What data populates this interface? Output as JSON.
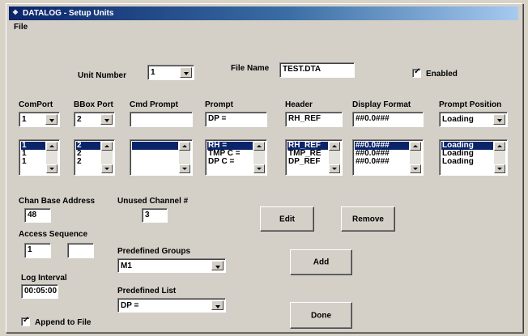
{
  "window": {
    "title": "DATALOG - Setup Units"
  },
  "menu": {
    "items": [
      "File"
    ]
  },
  "unit": {
    "number_label": "Unit Number",
    "number_value": "1",
    "filename_label": "File Name",
    "filename_value": "TEST.DTA",
    "enabled_label": "Enabled",
    "enabled": true
  },
  "columns": {
    "comport": "ComPort",
    "bbox_port": "BBox Port",
    "cmd_prompt": "Cmd Prompt",
    "prompt": "Prompt",
    "header": "Header",
    "display_format": "Display Format",
    "prompt_position": "Prompt  Position"
  },
  "edit_row": {
    "comport": "1",
    "bbox_port": "2",
    "cmd_prompt": "",
    "prompt": "DP  =",
    "header": "RH_REF",
    "display_format": "##0.0###",
    "prompt_position": "Loading"
  },
  "lists": {
    "comport": [
      "1",
      "1",
      "1"
    ],
    "bbox_port": [
      "2",
      "2",
      "2"
    ],
    "cmd_prompt": [
      "",
      "",
      ""
    ],
    "prompt": [
      "RH  =",
      "TMP C  =",
      "DP C  ="
    ],
    "header": [
      "RH_REF",
      "TMP_RE",
      "DP_REF"
    ],
    "display_format": [
      "##0.0###",
      "##0.0###",
      "##0.0###"
    ],
    "prompt_position": [
      "Loading",
      "Loading",
      "Loading"
    ]
  },
  "chan": {
    "base_label": "Chan Base Address",
    "base_value": "48",
    "unused_label": "Unused Channel #",
    "unused_value": "3"
  },
  "access": {
    "label": "Access Sequence",
    "value1": "1",
    "value2": ""
  },
  "log": {
    "label": "Log Interval",
    "value": "00:05:00"
  },
  "groups": {
    "label": "Predefined Groups",
    "value": "M1"
  },
  "plist": {
    "label": "Predefined List",
    "value": "DP  ="
  },
  "append": {
    "label": "Append to File",
    "checked": true
  },
  "buttons": {
    "edit": "Edit",
    "remove": "Remove",
    "add": "Add",
    "done": "Done"
  },
  "colors": {
    "title_start": "#0a246a",
    "title_end": "#a6caf0",
    "selection": "#0a246a",
    "face": "#d4d0c8"
  }
}
